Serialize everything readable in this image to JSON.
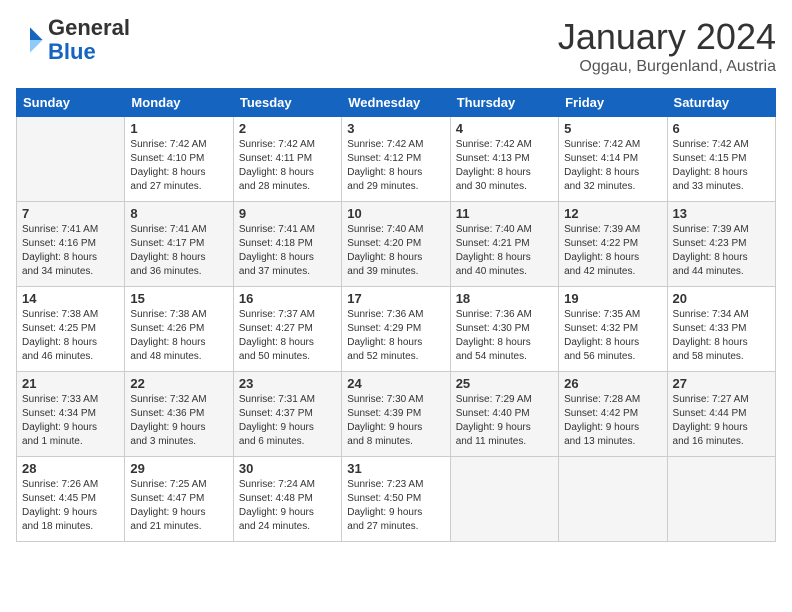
{
  "header": {
    "logo_line1": "General",
    "logo_line2": "Blue",
    "title": "January 2024",
    "subtitle": "Oggau, Burgenland, Austria"
  },
  "calendar": {
    "days_of_week": [
      "Sunday",
      "Monday",
      "Tuesday",
      "Wednesday",
      "Thursday",
      "Friday",
      "Saturday"
    ],
    "weeks": [
      [
        {
          "day": "",
          "info": ""
        },
        {
          "day": "1",
          "info": "Sunrise: 7:42 AM\nSunset: 4:10 PM\nDaylight: 8 hours\nand 27 minutes."
        },
        {
          "day": "2",
          "info": "Sunrise: 7:42 AM\nSunset: 4:11 PM\nDaylight: 8 hours\nand 28 minutes."
        },
        {
          "day": "3",
          "info": "Sunrise: 7:42 AM\nSunset: 4:12 PM\nDaylight: 8 hours\nand 29 minutes."
        },
        {
          "day": "4",
          "info": "Sunrise: 7:42 AM\nSunset: 4:13 PM\nDaylight: 8 hours\nand 30 minutes."
        },
        {
          "day": "5",
          "info": "Sunrise: 7:42 AM\nSunset: 4:14 PM\nDaylight: 8 hours\nand 32 minutes."
        },
        {
          "day": "6",
          "info": "Sunrise: 7:42 AM\nSunset: 4:15 PM\nDaylight: 8 hours\nand 33 minutes."
        }
      ],
      [
        {
          "day": "7",
          "info": "Sunrise: 7:41 AM\nSunset: 4:16 PM\nDaylight: 8 hours\nand 34 minutes."
        },
        {
          "day": "8",
          "info": "Sunrise: 7:41 AM\nSunset: 4:17 PM\nDaylight: 8 hours\nand 36 minutes."
        },
        {
          "day": "9",
          "info": "Sunrise: 7:41 AM\nSunset: 4:18 PM\nDaylight: 8 hours\nand 37 minutes."
        },
        {
          "day": "10",
          "info": "Sunrise: 7:40 AM\nSunset: 4:20 PM\nDaylight: 8 hours\nand 39 minutes."
        },
        {
          "day": "11",
          "info": "Sunrise: 7:40 AM\nSunset: 4:21 PM\nDaylight: 8 hours\nand 40 minutes."
        },
        {
          "day": "12",
          "info": "Sunrise: 7:39 AM\nSunset: 4:22 PM\nDaylight: 8 hours\nand 42 minutes."
        },
        {
          "day": "13",
          "info": "Sunrise: 7:39 AM\nSunset: 4:23 PM\nDaylight: 8 hours\nand 44 minutes."
        }
      ],
      [
        {
          "day": "14",
          "info": "Sunrise: 7:38 AM\nSunset: 4:25 PM\nDaylight: 8 hours\nand 46 minutes."
        },
        {
          "day": "15",
          "info": "Sunrise: 7:38 AM\nSunset: 4:26 PM\nDaylight: 8 hours\nand 48 minutes."
        },
        {
          "day": "16",
          "info": "Sunrise: 7:37 AM\nSunset: 4:27 PM\nDaylight: 8 hours\nand 50 minutes."
        },
        {
          "day": "17",
          "info": "Sunrise: 7:36 AM\nSunset: 4:29 PM\nDaylight: 8 hours\nand 52 minutes."
        },
        {
          "day": "18",
          "info": "Sunrise: 7:36 AM\nSunset: 4:30 PM\nDaylight: 8 hours\nand 54 minutes."
        },
        {
          "day": "19",
          "info": "Sunrise: 7:35 AM\nSunset: 4:32 PM\nDaylight: 8 hours\nand 56 minutes."
        },
        {
          "day": "20",
          "info": "Sunrise: 7:34 AM\nSunset: 4:33 PM\nDaylight: 8 hours\nand 58 minutes."
        }
      ],
      [
        {
          "day": "21",
          "info": "Sunrise: 7:33 AM\nSunset: 4:34 PM\nDaylight: 9 hours\nand 1 minute."
        },
        {
          "day": "22",
          "info": "Sunrise: 7:32 AM\nSunset: 4:36 PM\nDaylight: 9 hours\nand 3 minutes."
        },
        {
          "day": "23",
          "info": "Sunrise: 7:31 AM\nSunset: 4:37 PM\nDaylight: 9 hours\nand 6 minutes."
        },
        {
          "day": "24",
          "info": "Sunrise: 7:30 AM\nSunset: 4:39 PM\nDaylight: 9 hours\nand 8 minutes."
        },
        {
          "day": "25",
          "info": "Sunrise: 7:29 AM\nSunset: 4:40 PM\nDaylight: 9 hours\nand 11 minutes."
        },
        {
          "day": "26",
          "info": "Sunrise: 7:28 AM\nSunset: 4:42 PM\nDaylight: 9 hours\nand 13 minutes."
        },
        {
          "day": "27",
          "info": "Sunrise: 7:27 AM\nSunset: 4:44 PM\nDaylight: 9 hours\nand 16 minutes."
        }
      ],
      [
        {
          "day": "28",
          "info": "Sunrise: 7:26 AM\nSunset: 4:45 PM\nDaylight: 9 hours\nand 18 minutes."
        },
        {
          "day": "29",
          "info": "Sunrise: 7:25 AM\nSunset: 4:47 PM\nDaylight: 9 hours\nand 21 minutes."
        },
        {
          "day": "30",
          "info": "Sunrise: 7:24 AM\nSunset: 4:48 PM\nDaylight: 9 hours\nand 24 minutes."
        },
        {
          "day": "31",
          "info": "Sunrise: 7:23 AM\nSunset: 4:50 PM\nDaylight: 9 hours\nand 27 minutes."
        },
        {
          "day": "",
          "info": ""
        },
        {
          "day": "",
          "info": ""
        },
        {
          "day": "",
          "info": ""
        }
      ]
    ]
  }
}
